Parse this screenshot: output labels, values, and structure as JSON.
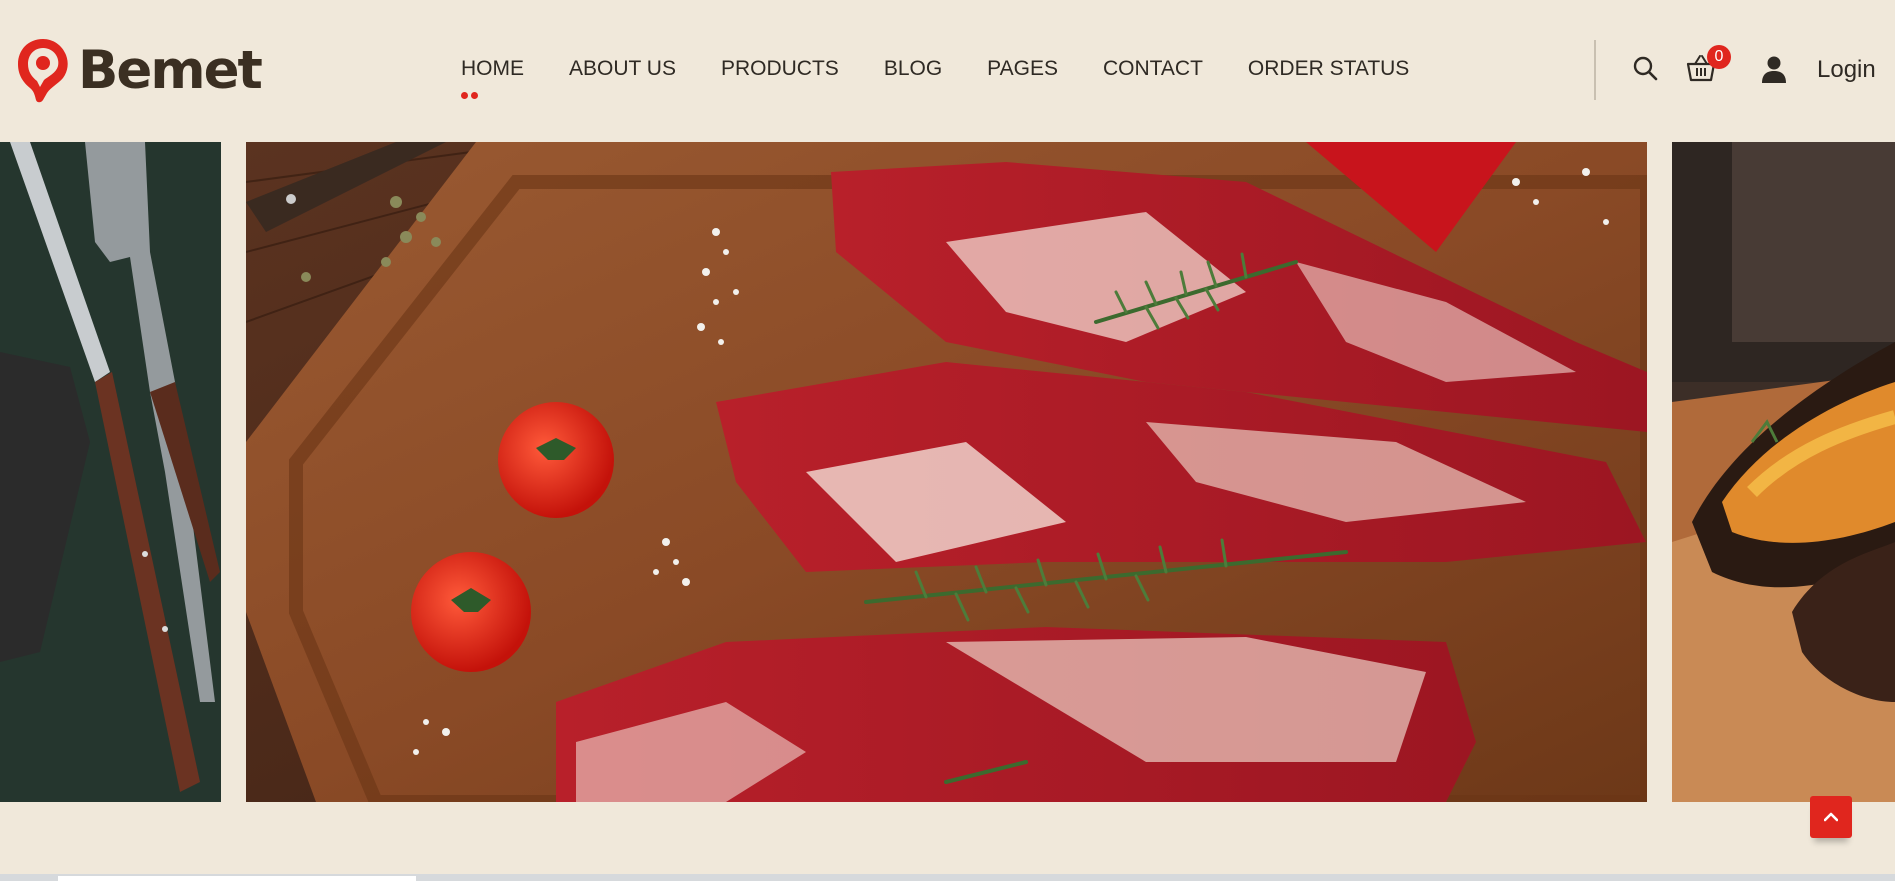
{
  "brand": {
    "name": "Bemet",
    "accent": "#e0261e",
    "text_color": "#3b2f22",
    "background": "#f0e8da"
  },
  "nav": {
    "items": [
      {
        "label": "HOME",
        "active": true
      },
      {
        "label": "ABOUT US",
        "active": false
      },
      {
        "label": "PRODUCTS",
        "active": false
      },
      {
        "label": "BLOG",
        "active": false
      },
      {
        "label": "PAGES",
        "active": false
      },
      {
        "label": "CONTACT",
        "active": false
      },
      {
        "label": "ORDER STATUS",
        "active": false
      }
    ]
  },
  "header_actions": {
    "search_icon": "search-icon",
    "cart_icon": "basket-icon",
    "cart_count": "0",
    "user_icon": "user-icon",
    "login_label": "Login"
  },
  "slider": {
    "slides": [
      {
        "name": "slide-prev",
        "subject": "knife-and-fork"
      },
      {
        "name": "slide-current",
        "subject": "raw-steaks-on-board"
      },
      {
        "name": "slide-next",
        "subject": "grilled-vegetables"
      }
    ]
  },
  "scroll_top": {
    "icon": "chevron-up-icon"
  }
}
